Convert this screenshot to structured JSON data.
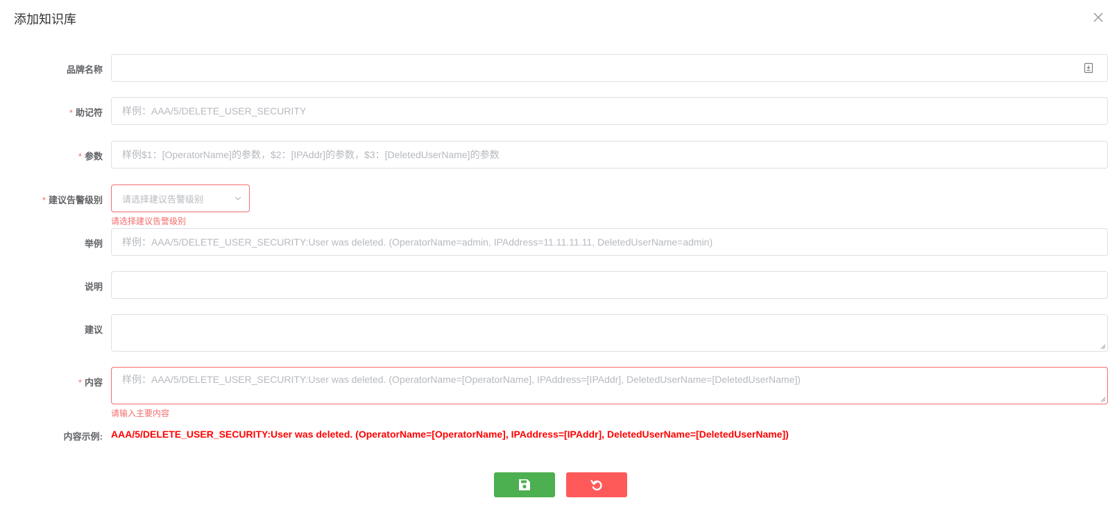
{
  "dialog": {
    "title": "添加知识库",
    "close_icon": "close-icon"
  },
  "form": {
    "brand": {
      "label": "品牌名称",
      "value": "",
      "icon": "clipboard-icon"
    },
    "mnemonic": {
      "label": "助记符",
      "required_mark": "*",
      "placeholder": "样例：AAA/5/DELETE_USER_SECURITY"
    },
    "params": {
      "label": "参数",
      "required_mark": "*",
      "placeholder": "样例$1：[OperatorName]的参数，$2：[IPAddr]的参数，$3：[DeletedUserName]的参数"
    },
    "alarm_level": {
      "label": "建议告警级别",
      "required_mark": "*",
      "placeholder": "请选择建议告警级别",
      "error": "请选择建议告警级别",
      "icon": "chevron-down-icon"
    },
    "example": {
      "label": "举例",
      "placeholder": "样例：AAA/5/DELETE_USER_SECURITY:User was deleted. (OperatorName=admin, IPAddress=11.11.11.11, DeletedUserName=admin)"
    },
    "description": {
      "label": "说明",
      "value": ""
    },
    "suggestion": {
      "label": "建议",
      "value": ""
    },
    "content": {
      "label": "内容",
      "required_mark": "*",
      "placeholder": "样例：AAA/5/DELETE_USER_SECURITY:User was deleted. (OperatorName=[OperatorName], IPAddress=[IPAddr], DeletedUserName=[DeletedUserName])",
      "error": "请输入主要内容"
    },
    "content_example": {
      "label": "内容示例:",
      "value": "AAA/5/DELETE_USER_SECURITY:User was deleted. (OperatorName=[OperatorName], IPAddress=[IPAddr], DeletedUserName=[DeletedUserName])"
    }
  },
  "actions": {
    "save_icon": "floppy-disk-icon",
    "reset_icon": "undo-icon"
  },
  "colors": {
    "required": "#f56c6c",
    "error": "#f56c6c",
    "example_text": "#ff0000",
    "save_button": "#4caf50",
    "reset_button": "#ff5a5a"
  }
}
